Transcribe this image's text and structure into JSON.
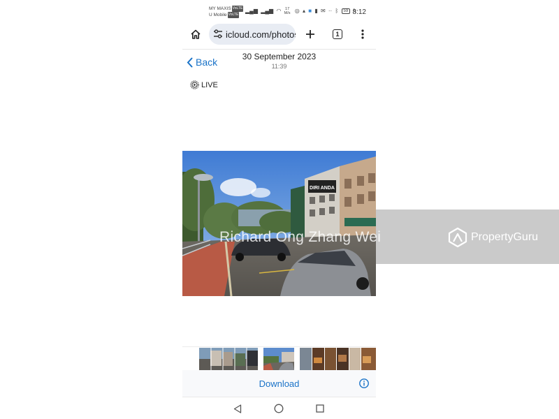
{
  "status_bar": {
    "carrier_1": "MY MAXIS",
    "carrier_1_tag": "VoLTE",
    "carrier_2": "U Mobile",
    "carrier_2_tag": "VoLTE",
    "speed_value": "17",
    "speed_unit": "M/s",
    "battery": "59",
    "time": "8:12"
  },
  "browser": {
    "url": "icloud.com/photos",
    "tab_count": "1"
  },
  "photo_view": {
    "back_label": "Back",
    "date": "30 September 2023",
    "time": "11:39",
    "live_label": "LIVE"
  },
  "storefront_sign": "DIRI ANDA",
  "bottom_bar": {
    "download_label": "Download"
  },
  "watermark": {
    "owner_text": "Richard Ong Zhang Wei",
    "brand_text": "PropertyGuru"
  },
  "colors": {
    "accent_blue": "#1a73c8",
    "url_pill": "#e8ecf3",
    "watermark_band": "#969696"
  },
  "icons": [
    "home-icon",
    "tune-icon",
    "plus-icon",
    "tabs-icon",
    "more-vert-icon",
    "chevron-left-icon",
    "live-photo-icon",
    "info-icon",
    "nav-back-icon",
    "nav-home-icon",
    "nav-recents-icon"
  ]
}
